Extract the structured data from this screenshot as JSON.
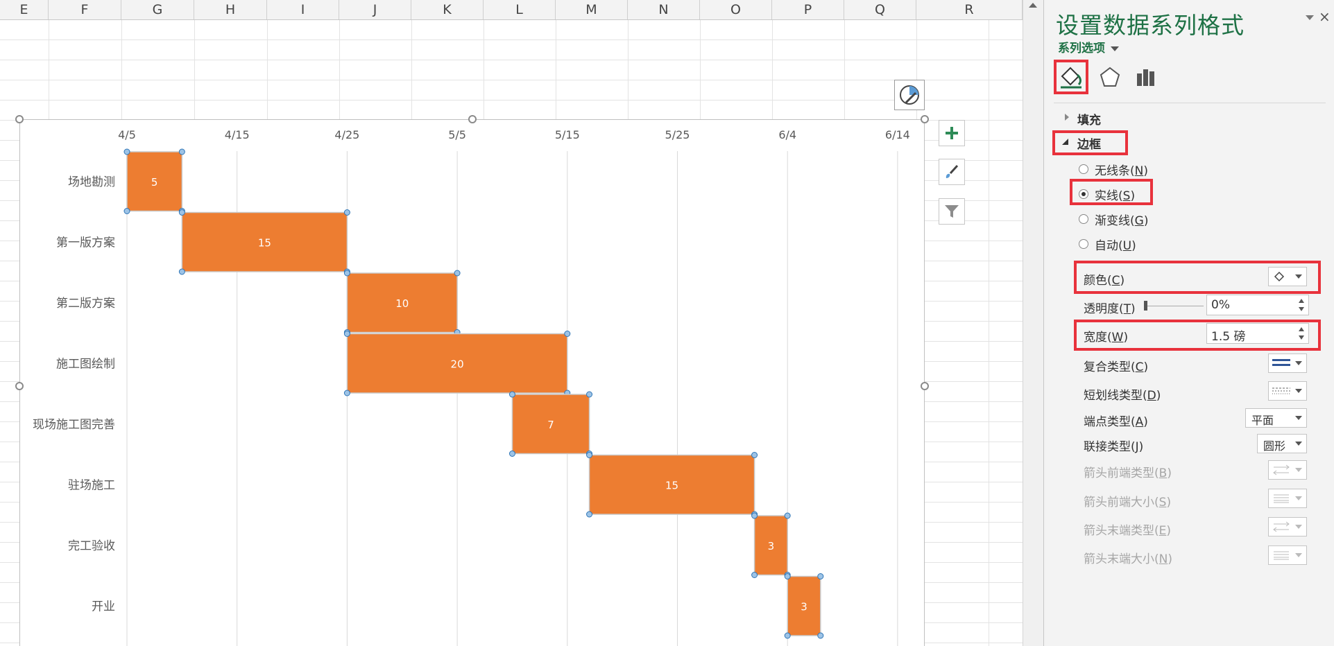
{
  "sheet": {
    "columns": [
      "E",
      "F",
      "G",
      "H",
      "I",
      "J",
      "K",
      "L",
      "M",
      "N",
      "O",
      "P",
      "Q",
      "R"
    ]
  },
  "chart_data": {
    "type": "bar",
    "orientation": "horizontal-gantt",
    "x_axis_position": "top",
    "x_ticks": [
      "4/5",
      "4/15",
      "4/25",
      "5/5",
      "5/15",
      "5/25",
      "6/4",
      "6/14"
    ],
    "tasks": [
      {
        "name": "场地勘测",
        "start": "4/5",
        "duration": 5
      },
      {
        "name": "第一版方案",
        "start": "4/10",
        "duration": 15
      },
      {
        "name": "第二版方案",
        "start": "4/25",
        "duration": 10
      },
      {
        "name": "施工图绘制",
        "start": "4/25",
        "duration": 20
      },
      {
        "name": "现场施工图完善",
        "start": "5/10",
        "duration": 7
      },
      {
        "name": "驻场施工",
        "start": "5/17",
        "duration": 15
      },
      {
        "name": "完工验收",
        "start": "6/1",
        "duration": 3
      },
      {
        "name": "开业",
        "start": "6/4",
        "duration": 3
      }
    ],
    "bar_color": "#ed7d31",
    "grid": true,
    "legend": "none"
  },
  "pane": {
    "title": "设置数据系列格式",
    "subtitle": "系列选项",
    "sections": {
      "fill": "填充",
      "border": "边框"
    },
    "line_options": [
      {
        "label": "无线条(",
        "key": "N",
        "selected": false
      },
      {
        "label": "实线(",
        "key": "S",
        "selected": true
      },
      {
        "label": "渐变线(",
        "key": "G",
        "selected": false
      },
      {
        "label": "自动(",
        "key": "U",
        "selected": false
      }
    ],
    "props": {
      "color": {
        "label": "颜色(",
        "key": "C"
      },
      "transparency": {
        "label": "透明度(",
        "key": "T",
        "value": "0%"
      },
      "width": {
        "label": "宽度(",
        "key": "W",
        "value": "1.5 磅"
      },
      "compound": {
        "label": "复合类型(",
        "key": "C"
      },
      "dash": {
        "label": "短划线类型(",
        "key": "D"
      },
      "cap": {
        "label": "端点类型(",
        "key": "A",
        "value": "平面"
      },
      "join": {
        "label": "联接类型(",
        "key": "J",
        "value": "圆形"
      },
      "begin_type": {
        "label": "箭头前端类型(",
        "key": "B"
      },
      "begin_size": {
        "label": "箭头前端大小(",
        "key": "S"
      },
      "end_type": {
        "label": "箭头末端类型(",
        "key": "E"
      },
      "end_size": {
        "label": "箭头末端大小(",
        "key": "N"
      }
    },
    "accent": "#1e7145",
    "highlight": "#e8323c"
  }
}
